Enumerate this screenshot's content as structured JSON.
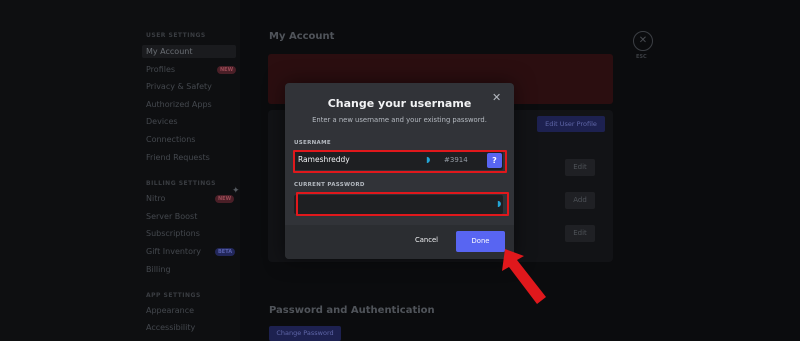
{
  "sidebar": {
    "headings": [
      "USER SETTINGS",
      "BILLING SETTINGS",
      "APP SETTINGS"
    ],
    "user_items": [
      "My Account",
      "Profiles",
      "Privacy & Safety",
      "Authorized Apps",
      "Devices",
      "Connections",
      "Friend Requests"
    ],
    "billing_items": [
      "Nitro",
      "Server Boost",
      "Subscriptions",
      "Gift Inventory",
      "Billing"
    ],
    "app_items": [
      "Appearance",
      "Accessibility"
    ],
    "badges": {
      "profiles": "NEW",
      "nitro": "NEW",
      "gift": "BETA"
    }
  },
  "content": {
    "title": "My Account",
    "edit_profile": "Edit User Profile",
    "edit1": "Edit",
    "add": "Add",
    "edit2": "Edit",
    "section2_title": "Password and Authentication",
    "change_password": "Change Password",
    "esc_label": "ESC"
  },
  "modal": {
    "title": "Change your username",
    "subtitle": "Enter a new username and your existing password.",
    "username_label": "USERNAME",
    "username_value": "Rameshreddy",
    "discriminator": "#3914",
    "help": "?",
    "password_label": "CURRENT PASSWORD",
    "password_value": "",
    "cancel": "Cancel",
    "done": "Done"
  },
  "colors": {
    "accent": "#5865f2",
    "highlight": "#e0181c",
    "modal_bg": "#313338"
  },
  "icons": {
    "close": "close-icon",
    "mic": "mic-icon",
    "arrow": "red-arrow"
  }
}
